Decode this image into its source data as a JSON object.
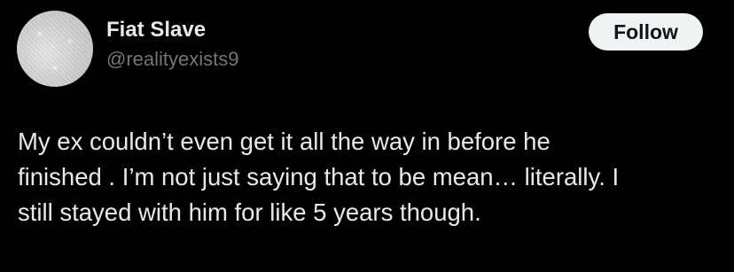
{
  "author": {
    "display_name": "Fiat Slave",
    "handle": "@realityexists9",
    "avatar_icon": "profile-avatar-icon"
  },
  "actions": {
    "follow_label": "Follow"
  },
  "tweet": {
    "lines": [
      "My ex couldn’t even get it all the way in before he",
      "finished . I’m not just saying that to be mean… literally. I",
      "still stayed with him for like 5 years though."
    ]
  },
  "colors": {
    "background": "#000000",
    "primary_text": "#e7e9ea",
    "secondary_text": "#71767b",
    "follow_button_bg": "#eff3f4",
    "follow_button_text": "#0f1419"
  }
}
